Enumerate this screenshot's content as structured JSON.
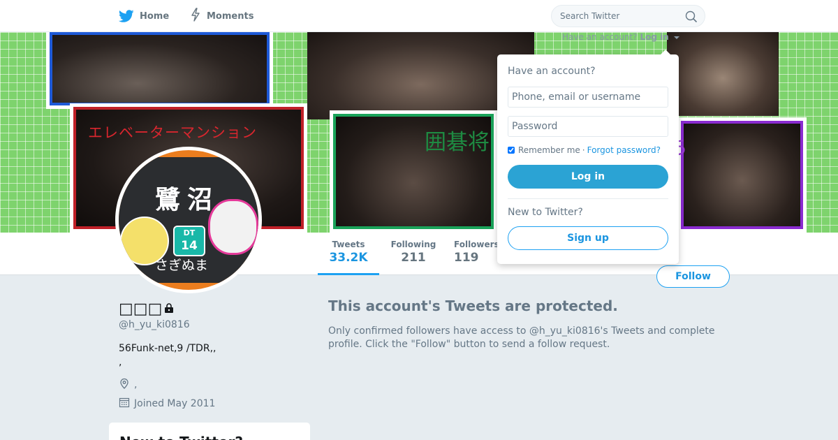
{
  "nav": {
    "home_label": "Home",
    "moments_label": "Moments",
    "search_placeholder": "Search Twitter"
  },
  "banner": {
    "text_1": "エレベーターマンション",
    "text_2": "囲碁将",
    "text_3": "ち"
  },
  "avatar": {
    "station_kanji": "鷺沼",
    "station_kana": "さぎぬま",
    "station_code_line": "DT",
    "station_code_num": "14"
  },
  "profile": {
    "name": "□□□",
    "handle": "@h_yu_ki0816",
    "bio": "56Funk-net,9 /TDR,,\n,",
    "location": ",",
    "joined": "Joined May 2011"
  },
  "stats": {
    "tweets_label": "Tweets",
    "tweets_value": "33.2K",
    "following_label": "Following",
    "following_value": "211",
    "followers_label": "Followers",
    "followers_value": "119"
  },
  "follow_button": "Follow",
  "protected": {
    "title": "This account's Tweets are protected.",
    "text": "Only confirmed followers have access to @h_yu_ki0816's Tweets and complete profile. Click the \"Follow\" button to send a follow request."
  },
  "signup_card_title": "New to Twitter?",
  "login_dropdown": {
    "trigger_prefix": "Have an account?",
    "trigger_link": "Log in",
    "heading": "Have an account?",
    "username_placeholder": "Phone, email or username",
    "password_placeholder": "Password",
    "remember_label": "Remember me",
    "separator": "·",
    "forgot_label": "Forgot password?",
    "login_button": "Log in",
    "new_heading": "New to Twitter?",
    "signup_button": "Sign up"
  },
  "colors": {
    "accent": "#1da1f2",
    "link": "#1b95e0",
    "background": "#e6ecf0"
  }
}
